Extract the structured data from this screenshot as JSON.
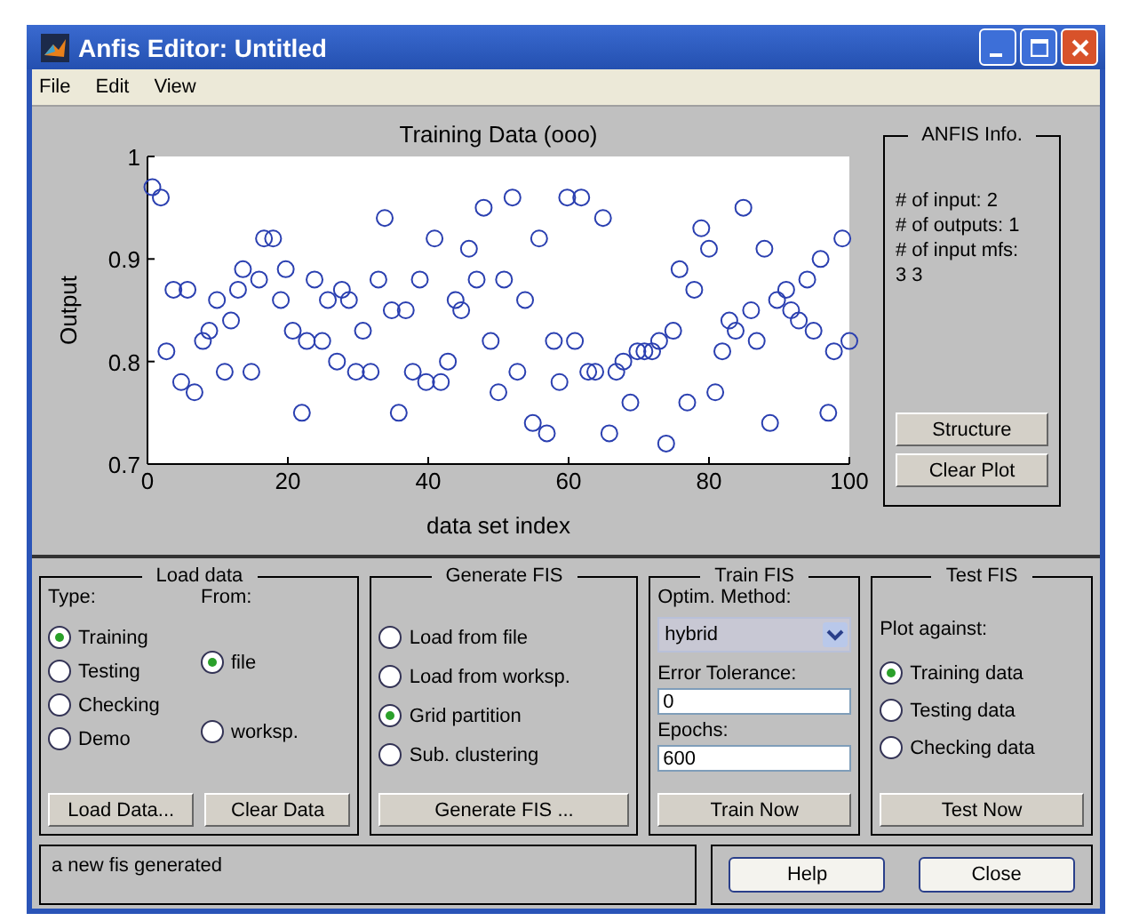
{
  "window": {
    "title": "Anfis Editor: Untitled"
  },
  "menu": [
    "File",
    "Edit",
    "View"
  ],
  "plot": {
    "chart_data": {
      "type": "scatter",
      "title": "Training Data (ooo)",
      "xlabel": "data set index",
      "ylabel": "Output",
      "xlim": [
        0,
        100
      ],
      "ylim": [
        0.7,
        1
      ],
      "xticks": [
        0,
        20,
        40,
        60,
        80,
        100
      ],
      "yticks": [
        0.7,
        0.8,
        0.9,
        1
      ],
      "x": [
        0.7,
        1.9,
        2.7,
        3.7,
        4.8,
        5.7,
        6.7,
        7.9,
        8.8,
        9.9,
        11,
        11.9,
        12.9,
        13.6,
        14.8,
        15.9,
        16.6,
        17.9,
        19,
        19.7,
        20.7,
        22,
        22.7,
        23.8,
        24.9,
        25.7,
        27,
        27.7,
        28.7,
        29.7,
        30.7,
        31.8,
        32.9,
        33.8,
        34.8,
        35.8,
        36.8,
        37.8,
        38.8,
        39.7,
        40.9,
        41.8,
        42.8,
        43.9,
        44.7,
        45.8,
        46.9,
        47.9,
        48.9,
        50,
        50.8,
        52,
        52.7,
        53.8,
        54.9,
        55.8,
        56.9,
        57.9,
        58.7,
        59.8,
        60.9,
        61.8,
        62.8,
        63.8,
        64.9,
        65.8,
        66.8,
        67.8,
        68.8,
        69.8,
        70.8,
        71.9,
        72.9,
        73.9,
        74.9,
        75.8,
        76.9,
        77.9,
        78.9,
        80,
        80.9,
        81.9,
        82.9,
        83.8,
        84.9,
        86,
        86.8,
        87.9,
        88.7,
        89.7,
        91,
        91.7,
        92.8,
        94,
        94.9,
        95.9,
        97,
        97.8,
        99,
        100
      ],
      "series": [
        {
          "color": "#2a3fb0",
          "values": [
            0.97,
            0.96,
            0.81,
            0.87,
            0.78,
            0.87,
            0.77,
            0.82,
            0.83,
            0.86,
            0.79,
            0.84,
            0.87,
            0.89,
            0.79,
            0.88,
            0.92,
            0.92,
            0.86,
            0.89,
            0.83,
            0.75,
            0.82,
            0.88,
            0.82,
            0.86,
            0.8,
            0.87,
            0.86,
            0.79,
            0.83,
            0.79,
            0.88,
            0.94,
            0.85,
            0.75,
            0.85,
            0.79,
            0.88,
            0.78,
            0.92,
            0.78,
            0.8,
            0.86,
            0.85,
            0.91,
            0.88,
            0.95,
            0.82,
            0.77,
            0.88,
            0.96,
            0.79,
            0.86,
            0.74,
            0.92,
            0.73,
            0.82,
            0.78,
            0.96,
            0.82,
            0.96,
            0.79,
            0.79,
            0.94,
            0.73,
            0.79,
            0.8,
            0.76,
            0.81,
            0.81,
            0.81,
            0.82,
            0.72,
            0.83,
            0.89,
            0.76,
            0.87,
            0.93,
            0.91,
            0.77,
            0.81,
            0.84,
            0.83,
            0.95,
            0.85,
            0.82,
            0.91,
            0.74,
            0.86,
            0.87,
            0.85,
            0.84,
            0.88,
            0.83,
            0.9,
            0.75,
            0.81,
            0.92,
            0.82
          ]
        }
      ]
    }
  },
  "info": {
    "title": "ANFIS Info.",
    "lines": [
      "# of input: 2",
      "# of outputs: 1",
      "# of input mfs:",
      "3  3"
    ],
    "buttons": [
      "Structure",
      "Clear Plot"
    ]
  },
  "load_data": {
    "title": "Load data",
    "type_label": "Type:",
    "from_label": "From:",
    "type_options": [
      {
        "label": "Training",
        "selected": true
      },
      {
        "label": "Testing",
        "selected": false
      },
      {
        "label": "Checking",
        "selected": false
      },
      {
        "label": "Demo",
        "selected": false
      }
    ],
    "from_options": [
      {
        "label": "file",
        "selected": true
      },
      {
        "label": "worksp.",
        "selected": false
      }
    ],
    "buttons": [
      "Load Data...",
      "Clear Data"
    ]
  },
  "generate_fis": {
    "title": "Generate FIS",
    "options": [
      {
        "label": "Load from file",
        "selected": false
      },
      {
        "label": "Load from worksp.",
        "selected": false
      },
      {
        "label": "Grid partition",
        "selected": true
      },
      {
        "label": "Sub. clustering",
        "selected": false
      }
    ],
    "button": "Generate FIS ..."
  },
  "train_fis": {
    "title": "Train FIS",
    "method_label": "Optim. Method:",
    "method": "hybrid",
    "tolerance_label": "Error Tolerance:",
    "tolerance": "0",
    "epochs_label": "Epochs:",
    "epochs": "600",
    "button": "Train Now"
  },
  "test_fis": {
    "title": "Test FIS",
    "label": "Plot against:",
    "options": [
      {
        "label": "Training data",
        "selected": true
      },
      {
        "label": "Testing data",
        "selected": false
      },
      {
        "label": "Checking data",
        "selected": false
      }
    ],
    "button": "Test Now"
  },
  "status": "a new fis generated",
  "buttons": [
    "Help",
    "Close"
  ]
}
